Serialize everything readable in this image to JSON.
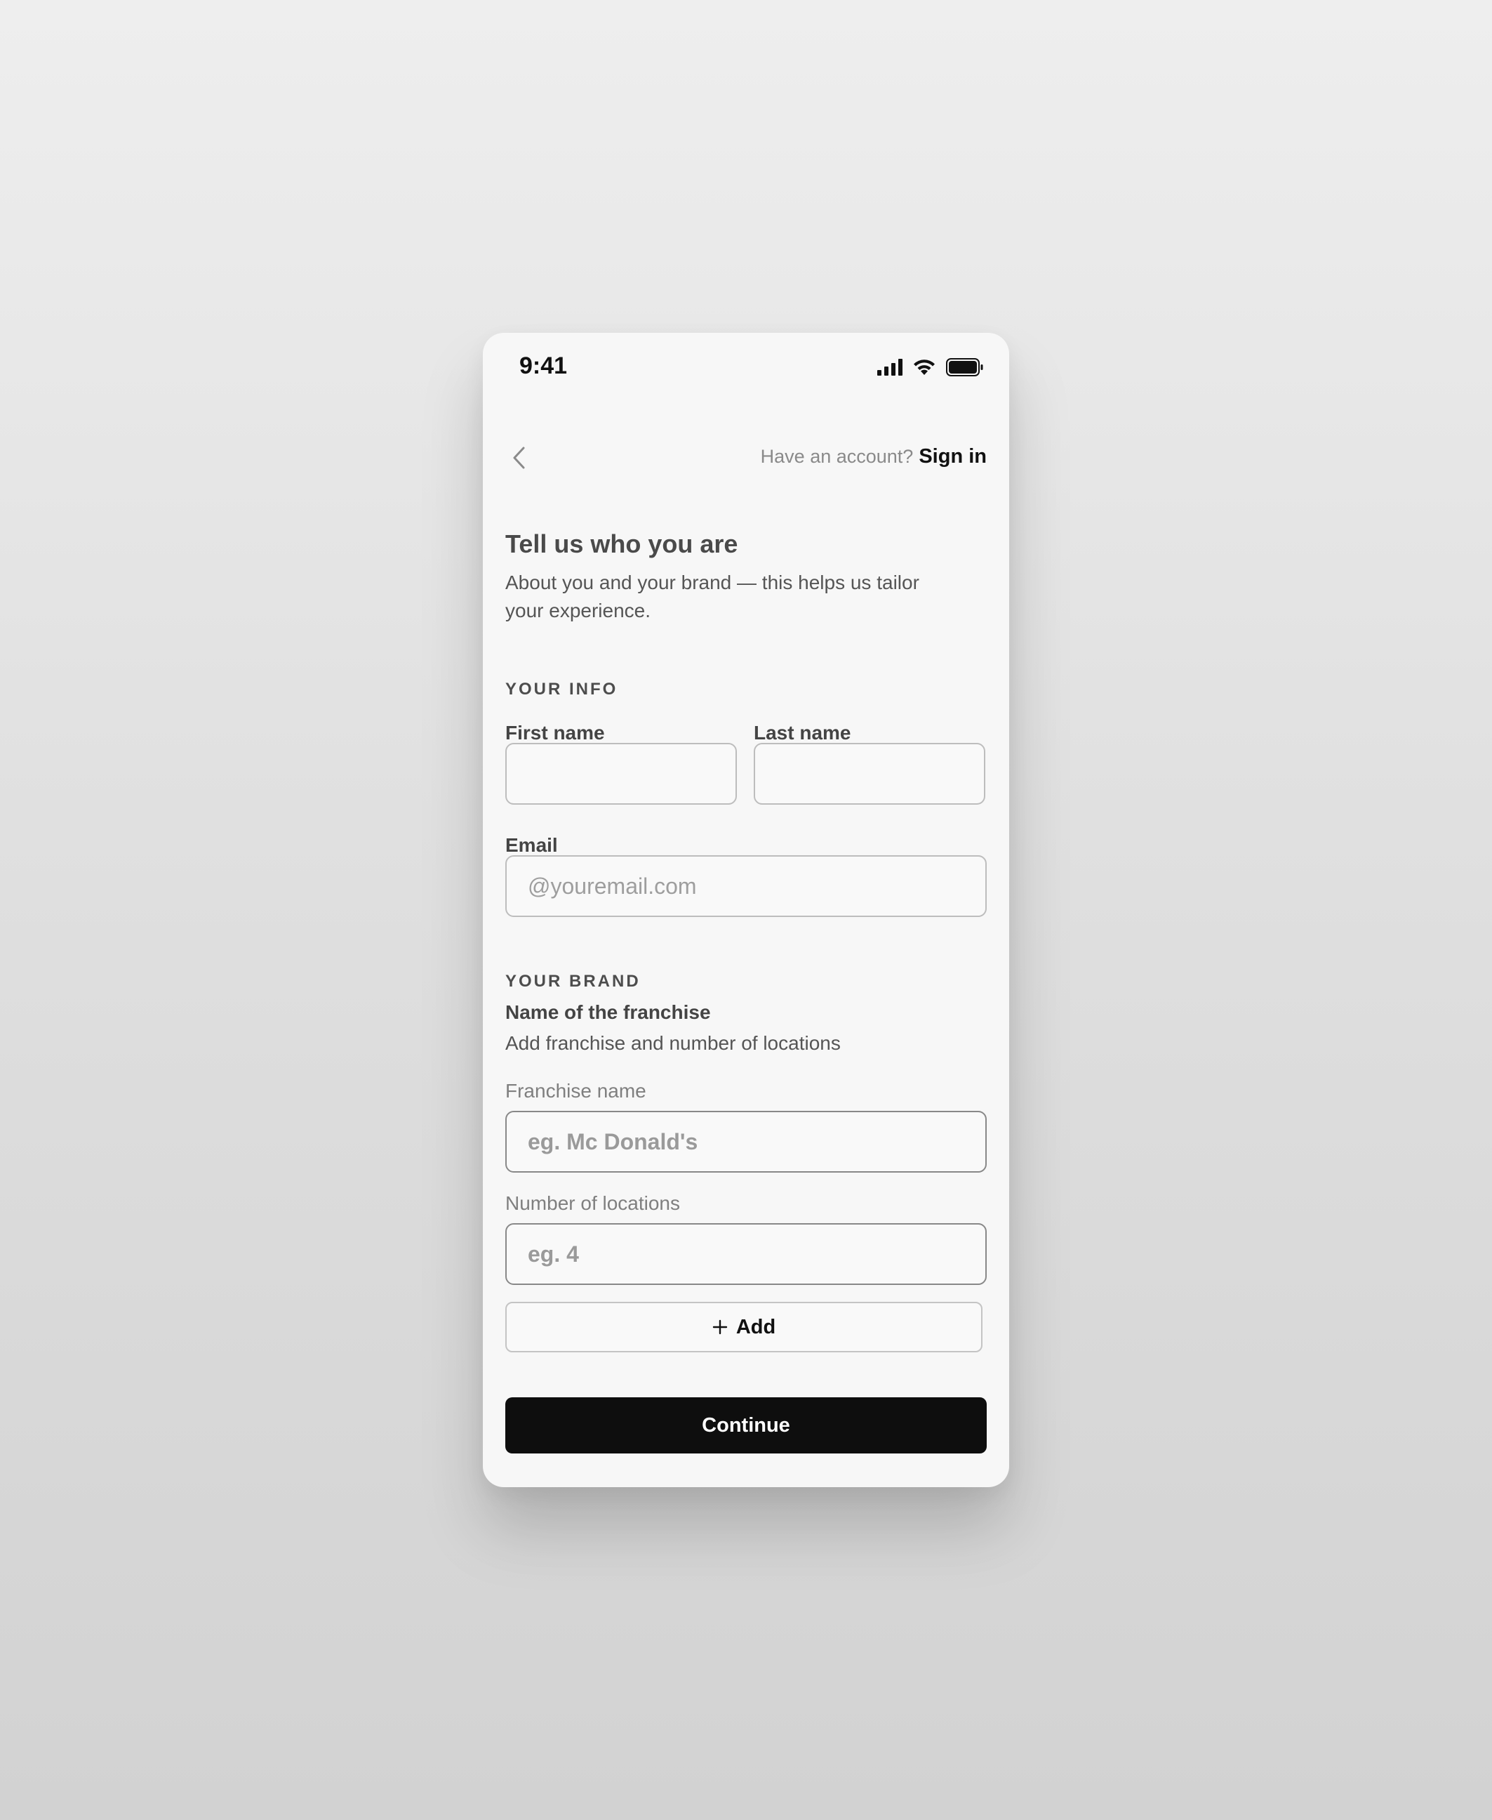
{
  "status_bar": {
    "time": "9:41"
  },
  "nav": {
    "back_icon": "chevron-left-icon",
    "account_prompt": "Have an account?",
    "sign_in": "Sign in"
  },
  "header": {
    "title": "Tell us who you are",
    "subtitle": "About you and your brand — this helps us tailor your experience."
  },
  "your_info": {
    "section_label": "YOUR INFO",
    "first_name": {
      "label": "First name",
      "value": "",
      "placeholder": ""
    },
    "last_name": {
      "label": "Last name",
      "value": "",
      "placeholder": ""
    },
    "email": {
      "label": "Email",
      "value": "",
      "placeholder": "@youremail.com"
    }
  },
  "your_brand": {
    "section_label": "YOUR BRAND",
    "franchise_heading": "Name of the franchise",
    "franchise_sub": "Add franchise and number of locations",
    "franchise_name": {
      "label": "Franchise name",
      "value": "",
      "placeholder": "eg. Mc Donald's"
    },
    "locations": {
      "label": "Number of locations",
      "value": "",
      "placeholder": "eg. 4"
    },
    "add_label": "Add"
  },
  "actions": {
    "continue_label": "Continue"
  },
  "colors": {
    "primary_button": "#0e0e0e",
    "card_background": "#f7f7f7"
  }
}
